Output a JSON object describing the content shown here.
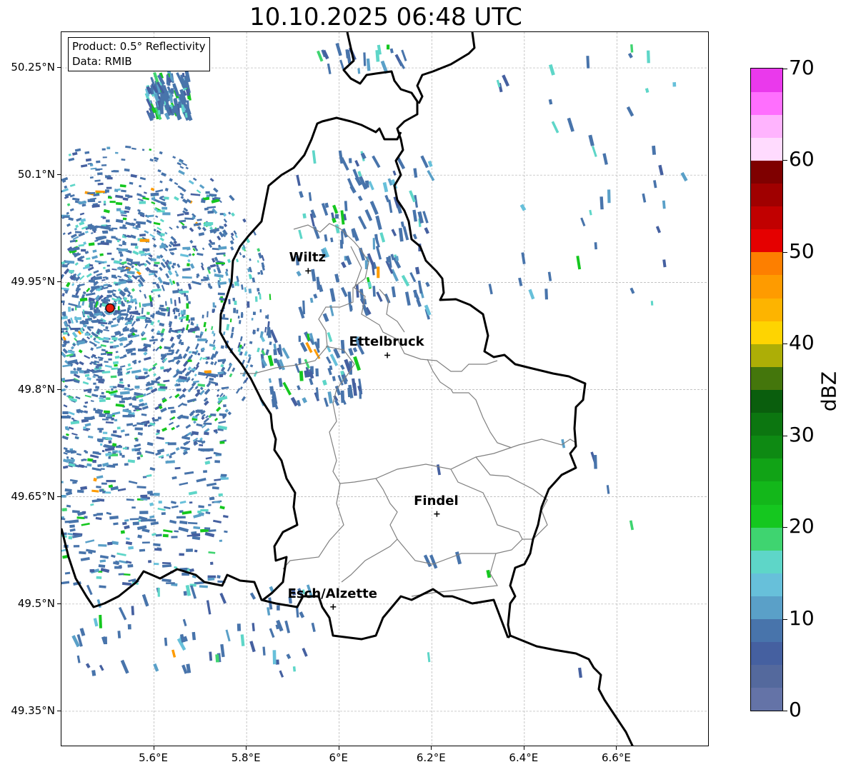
{
  "title": "10.10.2025 06:48 UTC",
  "info": {
    "product": "Product: 0.5° Reflectivity",
    "data": "Data: RMIB"
  },
  "map": {
    "extent": {
      "lon_min": 5.4,
      "lon_max": 6.8,
      "lat_min": 49.3,
      "lat_max": 50.3
    },
    "lat_ticks": [
      {
        "value": 50.25,
        "label": "50.25°N"
      },
      {
        "value": 50.1,
        "label": "50.1°N"
      },
      {
        "value": 49.95,
        "label": "49.95°N"
      },
      {
        "value": 49.8,
        "label": "49.8°N"
      },
      {
        "value": 49.65,
        "label": "49.65°N"
      },
      {
        "value": 49.5,
        "label": "49.5°N"
      },
      {
        "value": 49.35,
        "label": "49.35°N"
      }
    ],
    "lon_ticks": [
      {
        "value": 5.6,
        "label": "5.6°E"
      },
      {
        "value": 5.8,
        "label": "5.8°E"
      },
      {
        "value": 6.0,
        "label": "6°E"
      },
      {
        "value": 6.2,
        "label": "6.2°E"
      },
      {
        "value": 6.4,
        "label": "6.4°E"
      },
      {
        "value": 6.6,
        "label": "6.6°E"
      }
    ],
    "radar_site": {
      "lon": 5.505,
      "lat": 49.914
    },
    "cities": [
      {
        "name": "Wiltz",
        "lon": 5.933,
        "lat": 49.966
      },
      {
        "name": "Ettelbruck",
        "lon": 6.104,
        "lat": 49.848
      },
      {
        "name": "Findel",
        "lon": 6.211,
        "lat": 49.626
      },
      {
        "name": "Esch/Alzette",
        "lon": 5.987,
        "lat": 49.496
      }
    ]
  },
  "colorbar": {
    "label": "dBZ",
    "min": 0,
    "max": 70,
    "ticks": [
      {
        "value": 0,
        "label": "0"
      },
      {
        "value": 10,
        "label": "10"
      },
      {
        "value": 20,
        "label": "20"
      },
      {
        "value": 30,
        "label": "30"
      },
      {
        "value": 40,
        "label": "40"
      },
      {
        "value": 50,
        "label": "50"
      },
      {
        "value": 60,
        "label": "60"
      },
      {
        "value": 70,
        "label": "70"
      }
    ],
    "colors": [
      "#6473a7",
      "#54699d",
      "#4560a0",
      "#4874ab",
      "#5aa0c8",
      "#67c0da",
      "#5ed6c8",
      "#3fd470",
      "#15c71f",
      "#13b71a",
      "#11a316",
      "#0e8a13",
      "#0c7610",
      "#0a5e0d",
      "#44760c",
      "#adae06",
      "#fed401",
      "#fdb400",
      "#fe9b00",
      "#fd7f00",
      "#e50000",
      "#c10000",
      "#a00000",
      "#7f0000",
      "#ffdbfe",
      "#ffb4fe",
      "#ff6ffe",
      "#ea39ec"
    ]
  }
}
